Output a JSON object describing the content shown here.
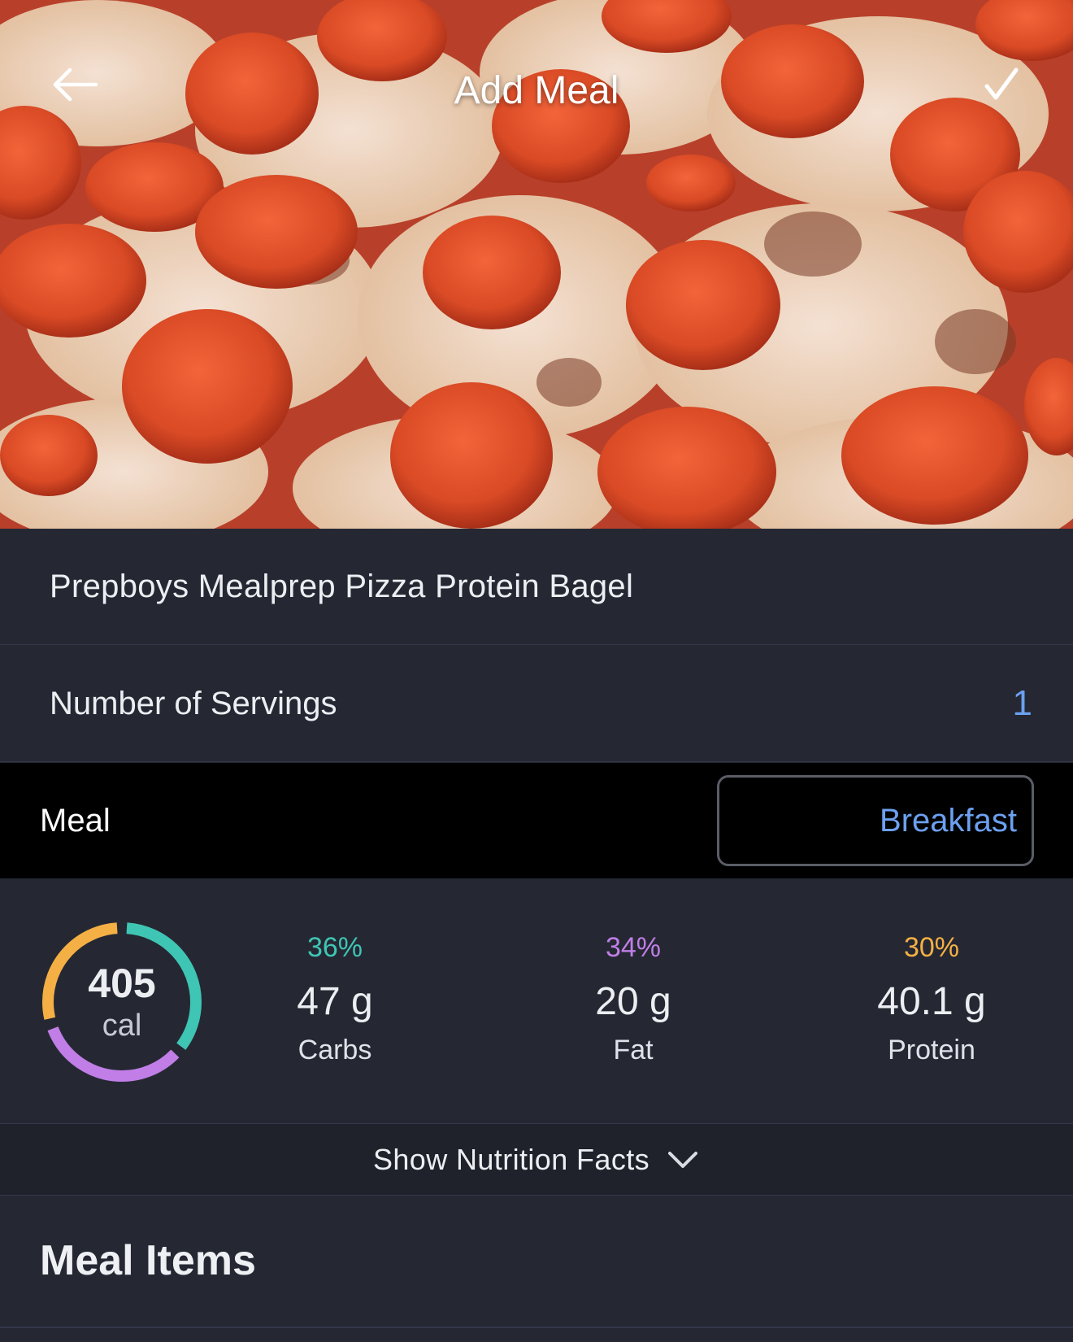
{
  "header": {
    "title": "Add Meal",
    "back_icon": "arrow-left-icon",
    "confirm_icon": "checkmark-icon"
  },
  "hero": {
    "image": "pepperoni-pizza-bagels-photo"
  },
  "meal_name": "Prepboys Mealprep Pizza Protein Bagel",
  "servings": {
    "label": "Number of Servings",
    "value": "1"
  },
  "meal": {
    "label": "Meal",
    "value": "Breakfast"
  },
  "summary": {
    "calories": "405",
    "calories_unit": "cal",
    "macros": [
      {
        "percent": "36%",
        "amount": "47 g",
        "name": "Carbs",
        "color": "#3fc5b4"
      },
      {
        "percent": "34%",
        "amount": "20 g",
        "name": "Fat",
        "color": "#c07ee6"
      },
      {
        "percent": "30%",
        "amount": "40.1 g",
        "name": "Protein",
        "color": "#f4b044"
      }
    ]
  },
  "nutrition_toggle": {
    "label": "Show Nutrition Facts",
    "icon": "chevron-down-icon"
  },
  "meal_items": {
    "title": "Meal Items"
  },
  "colors": {
    "accent": "#6ca0f0",
    "background": "#252833",
    "meal_row_background": "#000000"
  }
}
